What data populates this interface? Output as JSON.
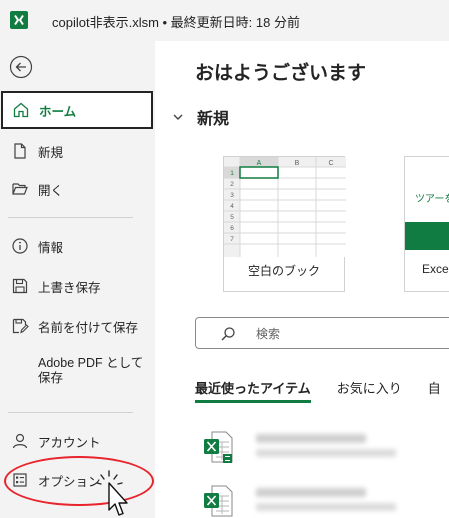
{
  "titlebar": {
    "app_icon": "excel-logo-icon",
    "title": "copilot非表示.xlsm • 最終更新日時: 18 分前"
  },
  "sidebar": {
    "back_icon": "back-arrow-icon",
    "items": [
      {
        "label": "ホーム",
        "icon": "home-icon"
      },
      {
        "label": "新規",
        "icon": "new-document-icon"
      },
      {
        "label": "開く",
        "icon": "open-folder-icon"
      },
      {
        "label": "情報",
        "icon": "info-icon"
      },
      {
        "label": "上書き保存",
        "icon": "save-icon"
      },
      {
        "label": "名前を付けて保存",
        "icon": "save-as-icon"
      },
      {
        "label": "Adobe PDF として保存",
        "icon": ""
      },
      {
        "label": "アカウント",
        "icon": "account-icon"
      },
      {
        "label": "オプション",
        "icon": "options-icon"
      }
    ]
  },
  "main": {
    "greeting": "おはようございます",
    "new_section_title": "新規",
    "templates": [
      {
        "label": "空白のブック"
      },
      {
        "label": "Exce",
        "preview_text": "ツアーを"
      }
    ],
    "blank_book_columns": [
      "A",
      "B",
      "C"
    ],
    "blank_book_rows": [
      "1",
      "2",
      "3",
      "4",
      "5",
      "6",
      "7"
    ],
    "search_placeholder": "検索",
    "tabs": [
      {
        "label": "最近使ったアイテム",
        "active": true
      },
      {
        "label": "お気に入り",
        "active": false
      },
      {
        "label": "自",
        "active": false
      }
    ]
  },
  "colors": {
    "accent": "#107c41",
    "highlight_ring": "#e8242c"
  }
}
